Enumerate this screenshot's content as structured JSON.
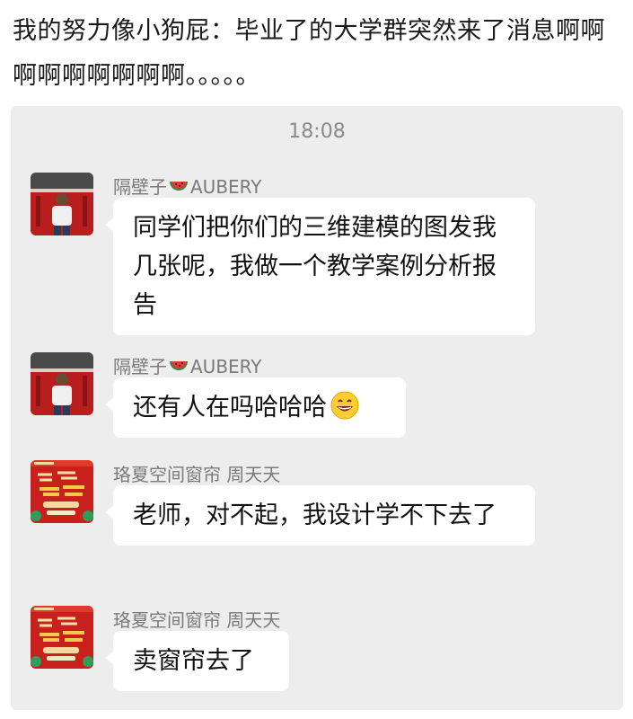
{
  "post": {
    "caption": "我的努力像小狗屁：毕业了的大学群突然来了消息啊啊啊啊啊啊啊啊啊。。。。。"
  },
  "chat": {
    "timestamp": "18:08",
    "messages": [
      {
        "sender_prefix": "隔壁子",
        "sender_suffix": "AUBERY",
        "text": "同学们把你们的三维建模的图发我几张呢，我做一个教学案例分析报告"
      },
      {
        "sender_prefix": "隔壁子",
        "sender_suffix": "AUBERY",
        "text": "还有人在吗哈哈哈"
      },
      {
        "sender": "珞夏空间窗帘 周天天",
        "text": "老师，对不起，我设计学不下去了"
      },
      {
        "sender": "珞夏空间窗帘 周天天",
        "text": "卖窗帘去了"
      }
    ]
  },
  "icons": {
    "sender_badge": "watermelon-icon",
    "message_emoji": "grinning-face-icon",
    "teacher_avatar": "person-photo-avatar",
    "student_avatar": "curtain-shop-poster-avatar"
  },
  "colors": {
    "chat_background": "#ededed",
    "bubble": "#ffffff",
    "sender_text": "#7a7a7a",
    "timestamp_text": "#8a8a8a",
    "avatar_red": "#c8201c"
  }
}
